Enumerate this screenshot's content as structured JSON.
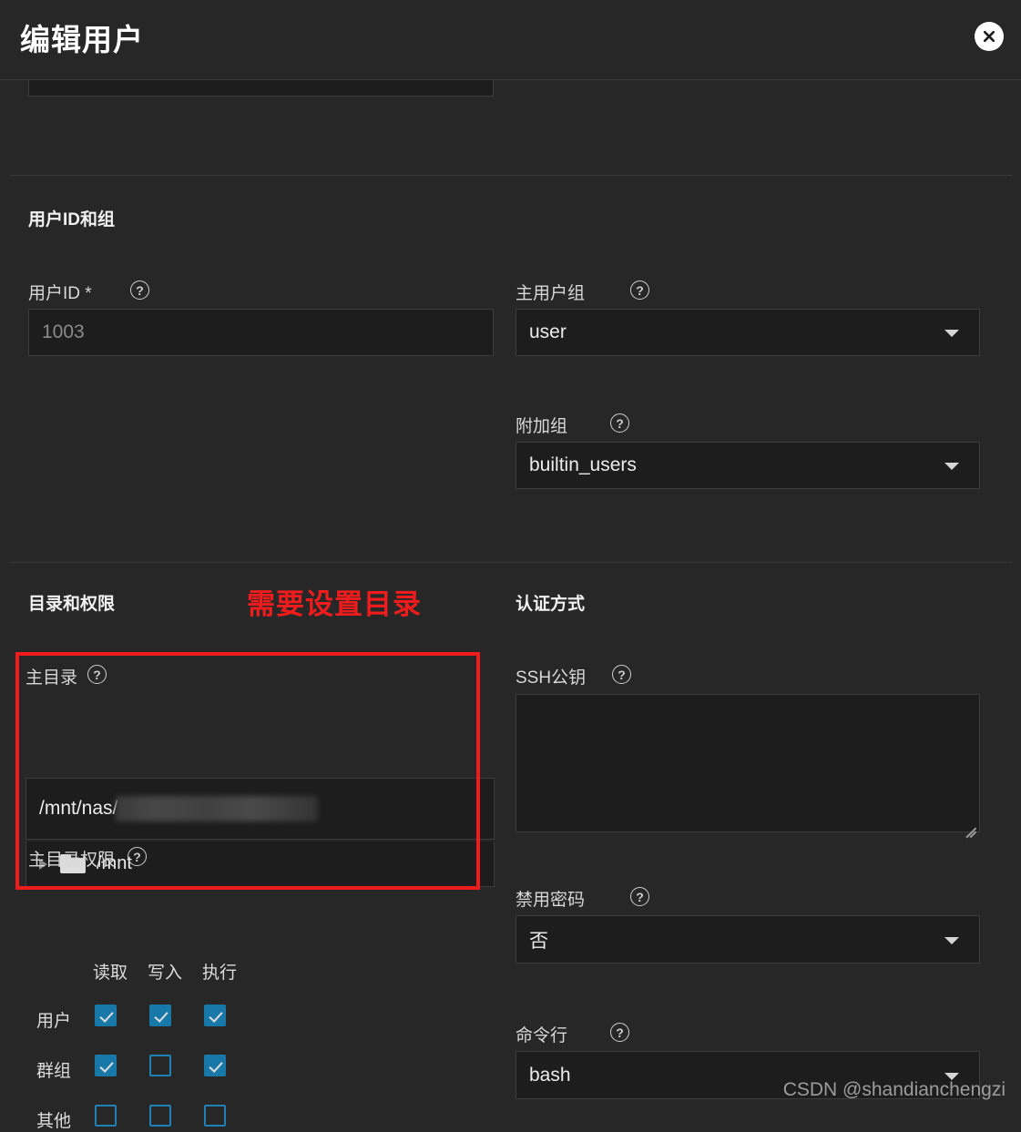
{
  "dialog": {
    "title": "编辑用户",
    "close_label": "×"
  },
  "annotation": {
    "note_text": "需要设置目录",
    "note_color": "#ee1c1c",
    "box_color": "#f01c1c"
  },
  "sections": {
    "ids_and_groups": {
      "title": "用户ID和组",
      "uid": {
        "label": "用户ID *",
        "help": "?",
        "value": "1003"
      },
      "primary_group": {
        "label": "主用户组",
        "help": "?",
        "value": "user"
      },
      "aux_groups": {
        "label": "附加组",
        "help": "?",
        "value": "builtin_users"
      }
    },
    "directories_and_permissions": {
      "title": "目录和权限",
      "home_dir": {
        "label": "主目录",
        "help": "?",
        "value": "/mnt/nas/",
        "redacted": true
      },
      "tree": {
        "items": [
          {
            "name": "/mnt",
            "icon": "folder-icon",
            "expanded": false
          }
        ]
      },
      "home_dir_perms": {
        "label": "主目录权限",
        "help": "?",
        "columns": [
          "读取",
          "写入",
          "执行"
        ],
        "rows": [
          {
            "label": "用户",
            "values": [
              true,
              true,
              true
            ]
          },
          {
            "label": "群组",
            "values": [
              true,
              false,
              true
            ]
          },
          {
            "label": "其他",
            "values": [
              false,
              false,
              false
            ]
          }
        ],
        "checked_color": "#1878a8",
        "border_color": "#1e82b4"
      }
    },
    "auth_method": {
      "title": "认证方式",
      "ssh_key": {
        "label": "SSH公钥",
        "help": "?",
        "value": "",
        "placeholder": ""
      },
      "disable_password": {
        "label": "禁用密码",
        "help": "?",
        "value": "否"
      },
      "shell": {
        "label": "命令行",
        "help": "?",
        "value": "bash"
      }
    }
  },
  "watermark": {
    "text": "CSDN @shandianchengzi"
  }
}
